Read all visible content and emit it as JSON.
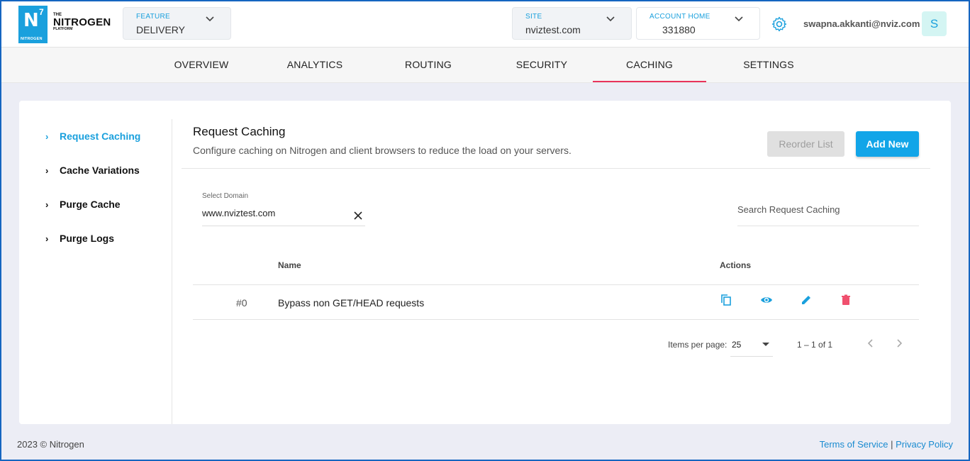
{
  "brand": {
    "logo_letter": "N",
    "logo_sup": "7",
    "logo_small": "NITROGEN",
    "the": "THE",
    "name": "NITROGEN",
    "platform": "PLATFORM"
  },
  "header": {
    "feature": {
      "label": "FEATURE",
      "value": "DELIVERY"
    },
    "site": {
      "label": "SITE",
      "value": "nviztest.com"
    },
    "account": {
      "label": "ACCOUNT HOME",
      "value": "331880"
    },
    "settings_icon": "gear-icon",
    "email": "swapna.akkanti@nviz.com",
    "avatar_initial": "S"
  },
  "tabs": [
    {
      "label": "OVERVIEW"
    },
    {
      "label": "ANALYTICS"
    },
    {
      "label": "ROUTING"
    },
    {
      "label": "SECURITY"
    },
    {
      "label": "CACHING",
      "active": true
    },
    {
      "label": "SETTINGS"
    }
  ],
  "sidebar": {
    "items": [
      {
        "label": "Request Caching",
        "active": true
      },
      {
        "label": "Cache Variations"
      },
      {
        "label": "Purge Cache"
      },
      {
        "label": "Purge Logs"
      }
    ]
  },
  "main": {
    "title": "Request Caching",
    "subtitle": "Configure caching on Nitrogen and client browsers to reduce the load on your servers.",
    "reorder_label": "Reorder List",
    "add_label": "Add New",
    "domain": {
      "label": "Select Domain",
      "value": "www.nviztest.com"
    },
    "search_placeholder": "Search Request Caching",
    "table": {
      "headers": {
        "name": "Name",
        "actions": "Actions"
      },
      "rows": [
        {
          "index": "#0",
          "name": "Bypass non GET/HEAD requests"
        }
      ]
    },
    "pagination": {
      "items_label": "Items per page:",
      "items_value": "25",
      "range": "1 – 1 of 1"
    }
  },
  "footer": {
    "copyright": "2023 © Nitrogen",
    "terms": "Terms of Service",
    "separator": "|",
    "privacy": "Privacy Policy"
  },
  "colors": {
    "accent": "#1aa0dd",
    "active_tab_underline": "#e8335b",
    "delete": "#f0506e"
  }
}
